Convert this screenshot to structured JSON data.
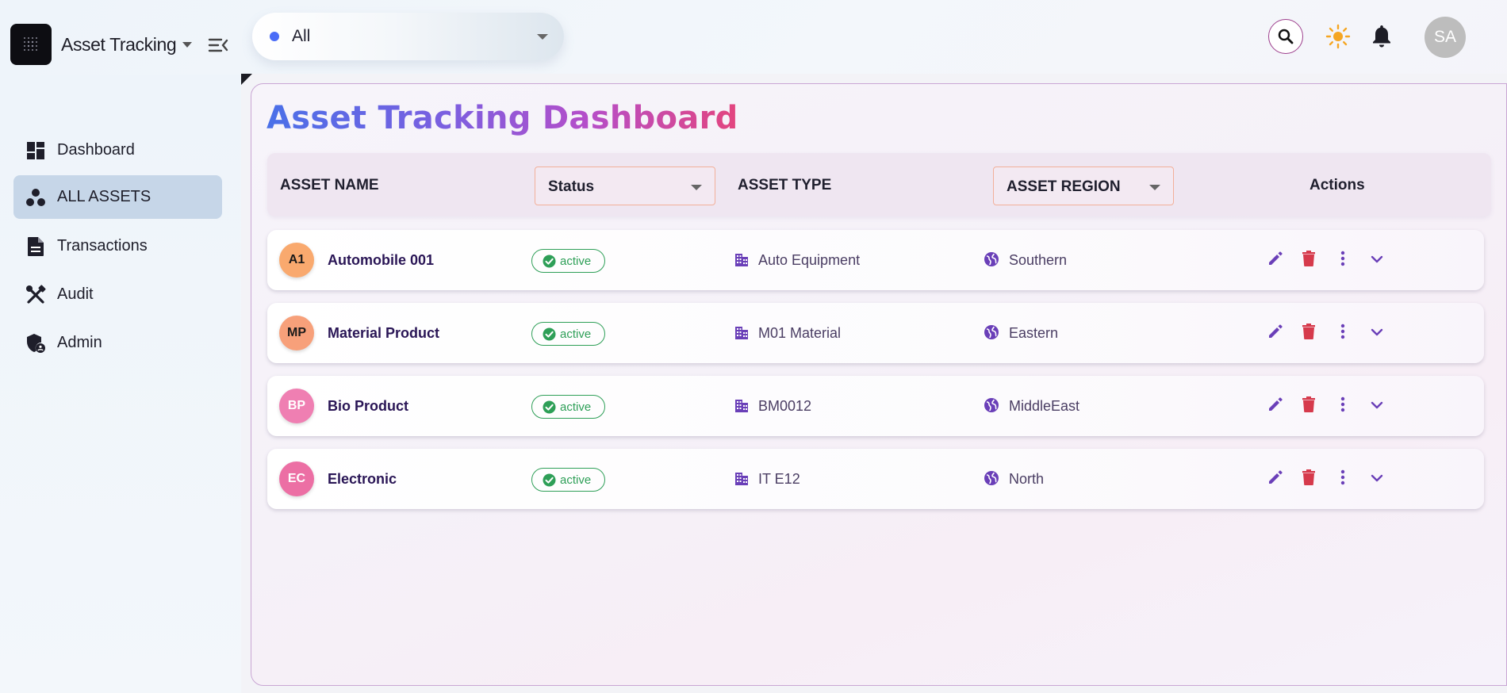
{
  "app": {
    "title": "Asset Tracking"
  },
  "filter": {
    "value": "All"
  },
  "header": {
    "avatar_initials": "SA"
  },
  "sidebar": {
    "items": [
      {
        "label": "Dashboard",
        "icon": "dashboard-icon"
      },
      {
        "label": "ALL ASSETS",
        "icon": "assets-icon",
        "active": true
      },
      {
        "label": "Transactions",
        "icon": "document-icon"
      },
      {
        "label": "Audit",
        "icon": "tools-icon"
      },
      {
        "label": "Admin",
        "icon": "admin-shield-icon"
      }
    ]
  },
  "page": {
    "title": "Asset Tracking Dashboard"
  },
  "table": {
    "columns": {
      "name": "ASSET NAME",
      "status": "Status",
      "type": "ASSET TYPE",
      "region": "ASSET REGION",
      "actions": "Actions"
    },
    "rows": [
      {
        "initials": "A1",
        "name": "Automobile 001",
        "status": "active",
        "type": "Auto Equipment",
        "region": "Southern",
        "avatar_color": "#f9a96e",
        "avatar_text_color": "#1a1a1a"
      },
      {
        "initials": "MP",
        "name": "Material Product",
        "status": "active",
        "type": "M01 Material",
        "region": "Eastern",
        "avatar_color": "#f7a07a",
        "avatar_text_color": "#1a1a1a"
      },
      {
        "initials": "BP",
        "name": "Bio Product",
        "status": "active",
        "type": "BM0012",
        "region": "MiddleEast",
        "avatar_color": "#ef7fb2",
        "avatar_text_color": "#ffffff"
      },
      {
        "initials": "EC",
        "name": "Electronic",
        "status": "active",
        "type": "IT E12",
        "region": "North",
        "avatar_color": "#ec6fa4",
        "avatar_text_color": "#ffffff"
      }
    ]
  },
  "colors": {
    "accent_purple": "#6a3fb8",
    "delete_red": "#d63a4c",
    "status_green": "#2e9f57",
    "sun_orange": "#f5a623"
  }
}
